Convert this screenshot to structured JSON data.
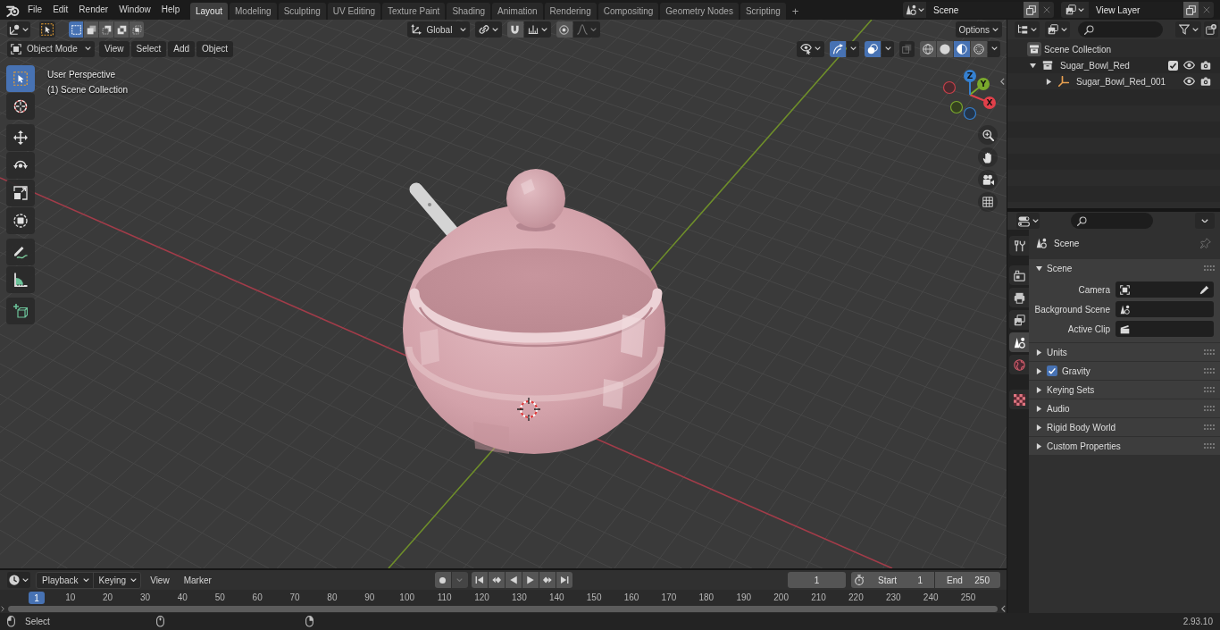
{
  "top_bar": {
    "menus": [
      "File",
      "Edit",
      "Render",
      "Window",
      "Help"
    ],
    "workspaces": [
      {
        "label": "Layout",
        "selected": true
      },
      {
        "label": "Modeling",
        "selected": false
      },
      {
        "label": "Sculpting",
        "selected": false
      },
      {
        "label": "UV Editing",
        "selected": false
      },
      {
        "label": "Texture Paint",
        "selected": false
      },
      {
        "label": "Shading",
        "selected": false
      },
      {
        "label": "Animation",
        "selected": false
      },
      {
        "label": "Rendering",
        "selected": false
      },
      {
        "label": "Compositing",
        "selected": false
      },
      {
        "label": "Geometry Nodes",
        "selected": false
      },
      {
        "label": "Scripting",
        "selected": false
      }
    ],
    "add_workspace": "+",
    "scene": "Scene",
    "view_layer": "View Layer"
  },
  "viewport": {
    "select_modes": [
      {
        "selected": true
      },
      {
        "selected": false
      },
      {
        "selected": false
      },
      {
        "selected": false
      },
      {
        "selected": false
      }
    ],
    "transform_orientation": "Global",
    "snap": false,
    "proportional_editing": false,
    "options": "Options",
    "mode": "Object Mode",
    "menus": [
      "View",
      "Select",
      "Add",
      "Object"
    ],
    "show_gizmos": true,
    "show_overlays": true,
    "xray": false,
    "shading_modes": [
      {
        "kind": "wireframe",
        "selected": false
      },
      {
        "kind": "solid",
        "selected": false
      },
      {
        "kind": "material",
        "selected": true
      },
      {
        "kind": "rendered",
        "selected": false
      }
    ],
    "info": [
      "User Perspective",
      "(1) Scene Collection"
    ],
    "tools": [
      {
        "kind": "select",
        "selected": true
      },
      {
        "kind": "cursor",
        "selected": false
      },
      {
        "kind": "move",
        "selected": false
      },
      {
        "kind": "rotate",
        "selected": false
      },
      {
        "kind": "scale",
        "selected": false
      },
      {
        "kind": "transform",
        "selected": false
      },
      {
        "kind": "annotate",
        "selected": false
      },
      {
        "kind": "measure",
        "selected": false
      },
      {
        "kind": "add_cube",
        "selected": false
      }
    ],
    "gizmo_axes": [
      "X",
      "Y",
      "Z"
    ]
  },
  "timeline": {
    "dropdowns": [
      "Playback",
      "Keying"
    ],
    "menus": [
      "View",
      "Marker"
    ],
    "auto_keying": false,
    "current_frame": "1",
    "start": {
      "label": "Start",
      "value": "1"
    },
    "end": {
      "label": "End",
      "value": "250"
    },
    "playhead": "1",
    "ruler": [
      "10",
      "20",
      "30",
      "40",
      "50",
      "60",
      "70",
      "80",
      "90",
      "100",
      "110",
      "120",
      "130",
      "140",
      "150",
      "160",
      "170",
      "180",
      "190",
      "200",
      "210",
      "220",
      "230",
      "240",
      "250"
    ]
  },
  "outliner": {
    "root": "Scene Collection",
    "items": [
      {
        "name": "Sugar_Bowl_Red",
        "kind": "collection",
        "expanded": true,
        "checked": true,
        "visible": true,
        "renderable": true,
        "children": [
          {
            "name": "Sugar_Bowl_Red_001",
            "kind": "empty",
            "expanded": false,
            "visible": true,
            "renderable": true
          }
        ]
      }
    ]
  },
  "properties": {
    "tabs": [
      {
        "kind": "tool",
        "selected": false
      },
      {
        "kind": "render",
        "selected": false
      },
      {
        "kind": "output",
        "selected": false
      },
      {
        "kind": "view_layer",
        "selected": false
      },
      {
        "kind": "scene",
        "selected": true
      },
      {
        "kind": "world",
        "selected": false
      },
      {
        "kind": "texture",
        "selected": false
      }
    ],
    "context": "Scene",
    "panels": [
      {
        "title": "Scene",
        "expanded": true,
        "fields": [
          {
            "label": "Camera",
            "kind": "object"
          },
          {
            "label": "Background Scene",
            "kind": "scene"
          },
          {
            "label": "Active Clip",
            "kind": "clip"
          }
        ]
      },
      {
        "title": "Units",
        "expanded": false
      },
      {
        "title": "Gravity",
        "expanded": false,
        "checked": true
      },
      {
        "title": "Keying Sets",
        "expanded": false
      },
      {
        "title": "Audio",
        "expanded": false
      },
      {
        "title": "Rigid Body World",
        "expanded": false
      },
      {
        "title": "Custom Properties",
        "expanded": false
      }
    ]
  },
  "status_bar": {
    "hints": [
      {
        "kind": "left",
        "label": "Select"
      },
      {
        "kind": "middle"
      },
      {
        "kind": "right"
      }
    ],
    "version": "2.93.10"
  }
}
